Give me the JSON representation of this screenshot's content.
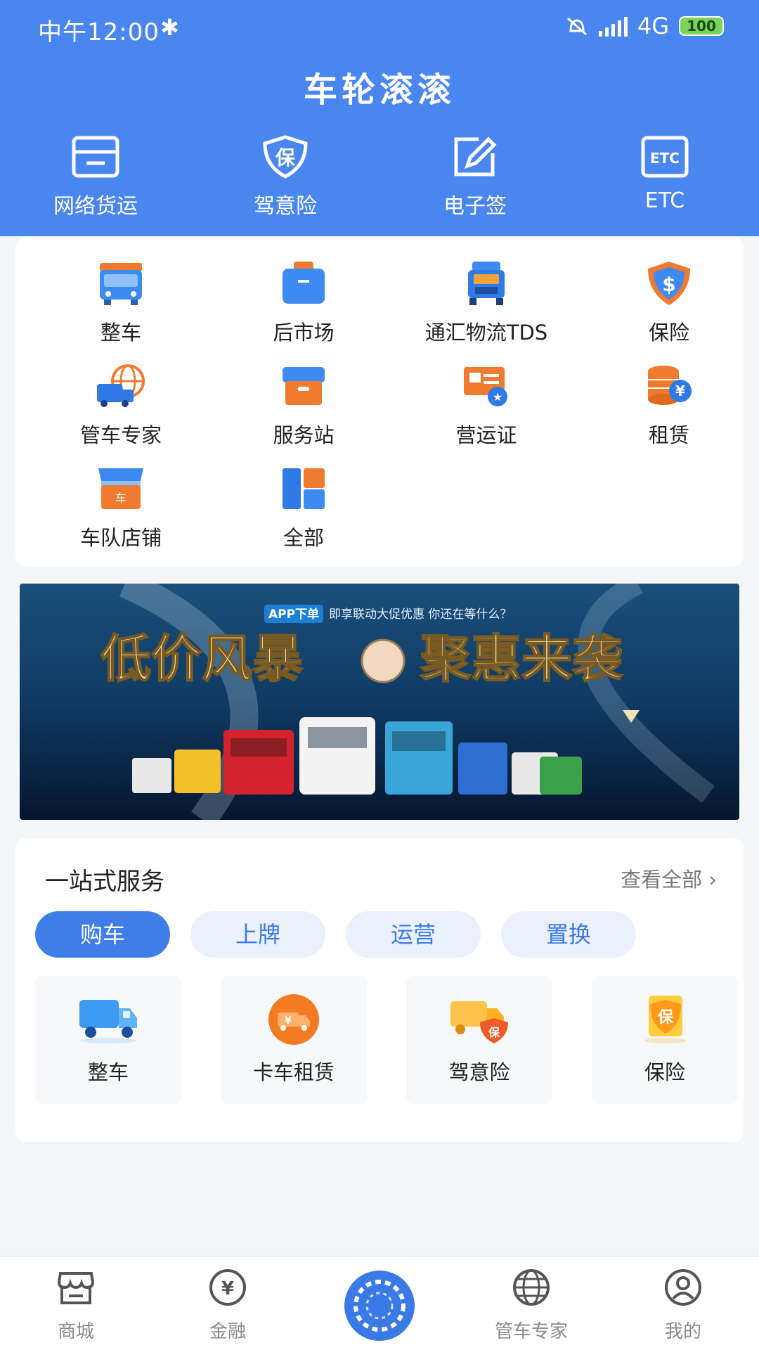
{
  "status_bar": {
    "time": "中午12:00",
    "network": "4G",
    "battery": "100"
  },
  "app_title": "车轮滚滚",
  "quick_actions": [
    {
      "label": "网络货运",
      "icon": "freight-box-icon"
    },
    {
      "label": "驾意险",
      "icon": "insurance-shield-icon",
      "glyph": "保"
    },
    {
      "label": "电子签",
      "icon": "e-sign-icon"
    },
    {
      "label": "ETC",
      "icon": "etc-icon",
      "glyph": "ETC"
    }
  ],
  "grid_items": [
    {
      "label": "整车",
      "icon": "truck-front-icon"
    },
    {
      "label": "后市场",
      "icon": "bag-icon"
    },
    {
      "label": "通汇物流TDS",
      "icon": "semi-truck-icon"
    },
    {
      "label": "保险",
      "icon": "dollar-shield-icon",
      "glyph": "$"
    },
    {
      "label": "管车专家",
      "icon": "globe-truck-icon"
    },
    {
      "label": "服务站",
      "icon": "service-box-icon"
    },
    {
      "label": "营运证",
      "icon": "certificate-icon"
    },
    {
      "label": "租赁",
      "icon": "coins-yen-icon",
      "glyph": "¥"
    },
    {
      "label": "车队店铺",
      "icon": "storefront-icon",
      "glyph": "车"
    },
    {
      "label": "全部",
      "icon": "all-blocks-icon"
    }
  ],
  "banner": {
    "tag": "APP下单",
    "subtitle": "即享联动大促优惠  你还在等什么？",
    "headline_left": "低价风暴",
    "headline_right": "聚惠来袭"
  },
  "services": {
    "title": "一站式服务",
    "more": "查看全部",
    "tabs": [
      "购车",
      "上牌",
      "运营",
      "置换"
    ],
    "active_tab": "购车",
    "cards": [
      {
        "label": "整车",
        "icon": "truck-side-icon"
      },
      {
        "label": "卡车租赁",
        "icon": "truck-rental-icon",
        "glyph": "¥"
      },
      {
        "label": "驾意险",
        "icon": "truck-insurance-icon",
        "glyph": "保"
      },
      {
        "label": "保险",
        "icon": "insurance-card-icon",
        "glyph": "保"
      }
    ]
  },
  "tab_bar": [
    {
      "label": "商城",
      "icon": "shop-icon"
    },
    {
      "label": "金融",
      "icon": "yen-circle-icon",
      "glyph": "¥"
    },
    {
      "label": "",
      "icon": "center-logo-icon"
    },
    {
      "label": "管车专家",
      "icon": "globe-icon"
    },
    {
      "label": "我的",
      "icon": "user-icon"
    }
  ],
  "colors": {
    "primary": "#4a86f0",
    "tab_active": "#3f7ee8",
    "background": "#f5f6f8"
  }
}
